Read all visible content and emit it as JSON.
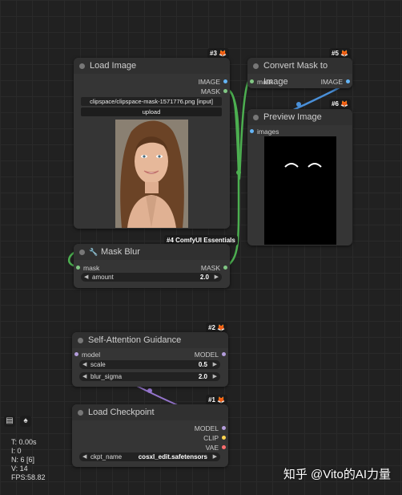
{
  "nodes": {
    "load_image": {
      "title": "Load Image",
      "badge": "#3",
      "outputs": [
        "IMAGE",
        "MASK"
      ],
      "image_value": "clipspace/clipspace-mask-1571776.png [input]",
      "upload_label": "upload",
      "footer_badge": "#4 ComfyUI Essentials"
    },
    "convert_mask": {
      "title": "Convert Mask to Image",
      "badge": "#5",
      "input": "mask",
      "output": "IMAGE"
    },
    "preview_image": {
      "title": "Preview Image",
      "badge": "#6",
      "input": "images"
    },
    "mask_blur": {
      "title": "Mask Blur",
      "input": "mask",
      "output": "MASK",
      "widget_label": "amount",
      "widget_value": "2.0"
    },
    "sag": {
      "title": "Self-Attention Guidance",
      "badge": "#2",
      "input": "model",
      "output": "MODEL",
      "widgets": [
        {
          "label": "scale",
          "value": "0.5"
        },
        {
          "label": "blur_sigma",
          "value": "2.0"
        }
      ]
    },
    "load_checkpoint": {
      "title": "Load Checkpoint",
      "badge": "#1",
      "outputs": [
        "MODEL",
        "CLIP",
        "VAE"
      ],
      "ckpt_label": "ckpt_name",
      "ckpt_value": "cosxl_edit.safetensors"
    }
  },
  "stats": {
    "t": "T: 0.00s",
    "i": "I: 0",
    "n": "N: 6 [6]",
    "v": "V: 14",
    "fps": "FPS:58.82"
  },
  "watermark": "知乎 @Vito的AI力量",
  "colors": {
    "image_socket": "#64b5f6",
    "mask_socket": "#81c784",
    "model_socket": "#b39ddb",
    "clip_socket": "#ffd54f",
    "vae_socket": "#ff6e6e",
    "mask_wire": "#4caf50",
    "image_wire": "#4a90d9",
    "model_wire": "#9575cd"
  }
}
